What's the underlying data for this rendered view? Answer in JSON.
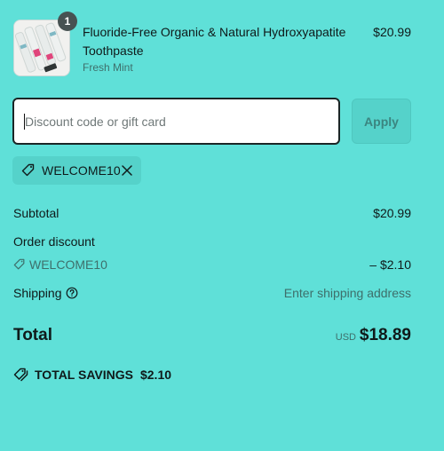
{
  "product": {
    "quantity": "1",
    "name": "Fluoride-Free Organic & Natural Hydroxyapatite Toothpaste",
    "variant": "Fresh Mint",
    "price": "$20.99"
  },
  "discount": {
    "placeholder": "Discount code or gift card",
    "apply_label": "Apply",
    "applied_code": "WELCOME10"
  },
  "summary": {
    "subtotal_label": "Subtotal",
    "subtotal_value": "$20.99",
    "order_discount_label": "Order discount",
    "discount_code": "WELCOME10",
    "discount_value": "– $2.10",
    "shipping_label": "Shipping",
    "shipping_value": "Enter shipping address",
    "total_label": "Total",
    "currency": "USD",
    "total_value": "$18.89",
    "savings_label": "TOTAL SAVINGS",
    "savings_value": "$2.10"
  },
  "icons": {
    "tag": "tag-icon",
    "remove": "close-icon",
    "help": "question-circle-icon",
    "savings": "double-tag-icon"
  },
  "colors": {
    "background": "#5fe0d8",
    "badge": "#475252",
    "muted_text": "#3e6f6b"
  }
}
